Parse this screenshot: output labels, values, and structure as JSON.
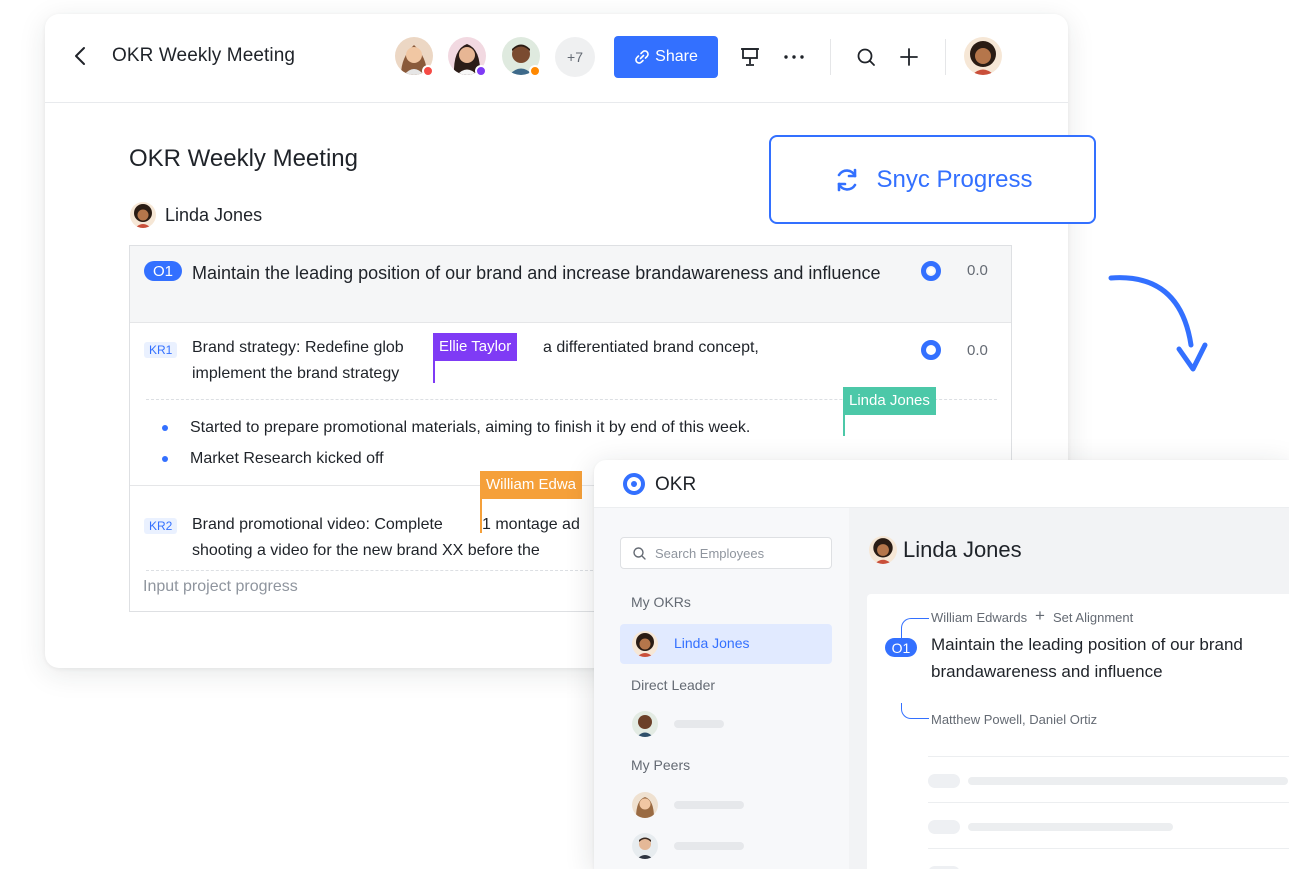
{
  "header": {
    "back_label": "Back",
    "title": "OKR Weekly Meeting",
    "more_collaborators": "+7",
    "share_label": "Share",
    "collaborators": [
      {
        "name": "collaborator-1",
        "status_color": "#f54a45"
      },
      {
        "name": "collaborator-2",
        "status_color": "#7f3bf5"
      },
      {
        "name": "collaborator-3",
        "status_color": "#ff8800"
      }
    ],
    "icons": [
      "back-icon",
      "link-icon",
      "present-icon",
      "more-icon",
      "search-icon",
      "plus-icon"
    ]
  },
  "document": {
    "title": "OKR Weekly Meeting",
    "owner": "Linda Jones",
    "objective": {
      "badge": "O1",
      "text": "Maintain the leading position of our brand and increase brandawareness and influence",
      "progress": "0.0"
    },
    "key_results": [
      {
        "badge": "KR1",
        "text_line1_a": "Brand strategy: Redefine glob",
        "text_line1_b": "a differentiated brand concept,",
        "text_line2": "implement the brand strategy",
        "progress": "0.0",
        "updates": [
          "Started to prepare promotional materials, aiming to finish it by end of this week.",
          "Market Research kicked off"
        ]
      },
      {
        "badge": "KR2",
        "text_line1_a": "Brand promotional video: Complete",
        "text_line1_b": "1 montage ad",
        "text_line2": "shooting a video for the new brand XX before the"
      }
    ],
    "input_placeholder": "Input project progress"
  },
  "cursors": [
    {
      "name": "Ellie Taylor",
      "color": "#7f3bf5"
    },
    {
      "name": "Linda Jones",
      "color": "#4cc8a8"
    },
    {
      "name": "William Edwa",
      "color": "#f5a03a"
    }
  ],
  "sync": {
    "label": "Snyc Progress"
  },
  "okr_app": {
    "title": "OKR",
    "search_placeholder": "Search Employees",
    "sections": {
      "my_okrs": "My OKRs",
      "direct_leader": "Direct Leader",
      "my_peers": "My Peers"
    },
    "active_item": "Linda Jones",
    "main": {
      "owner": "Linda Jones",
      "aligned_from": "William Edwards",
      "set_alignment": "Set Alignment",
      "objective_badge": "O1",
      "objective_line1": "Maintain the leading position of our brand",
      "objective_line2": "brandawareness and influence",
      "aligned_by": "Matthew Powell, Daniel Ortiz"
    }
  },
  "colors": {
    "accent": "#3370ff",
    "text_primary": "#1f2329",
    "text_secondary": "#646a73"
  }
}
